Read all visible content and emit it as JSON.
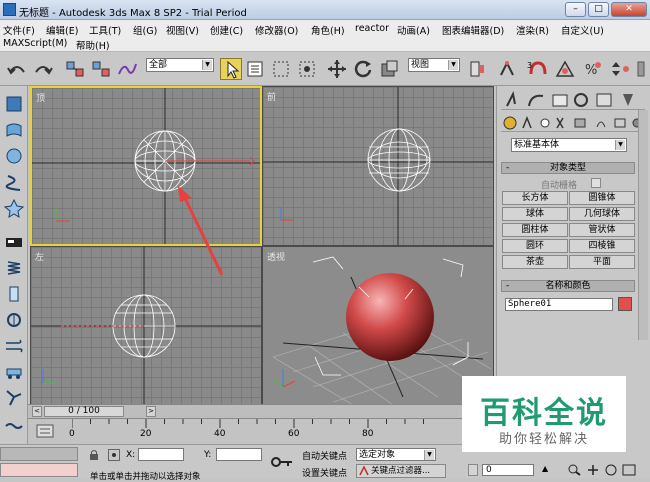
{
  "window": {
    "title": "无标题 - Autodesk 3ds Max 8 SP2 - Trial Period",
    "minimize": "–",
    "maximize": "□",
    "close": "✕"
  },
  "menu": {
    "row1": [
      "文件(F)",
      "编辑(E)",
      "工具(T)",
      "组(G)",
      "视图(V)",
      "创建(C)",
      "修改器(O)",
      "角色(H)",
      "reactor",
      "动画(A)",
      "图表编辑器(D)",
      "渲染(R)",
      "自定义(U)"
    ],
    "row2": [
      "MAXScript(M)",
      "帮助(H)"
    ]
  },
  "toolbar": {
    "selection_filter": "全部",
    "ref_coord": "视图"
  },
  "viewports": {
    "top": "顶",
    "front": "前",
    "left": "左",
    "persp": "透视"
  },
  "command_panel": {
    "category": "标准基本体",
    "object_type_header": "对象类型",
    "autogrid_label": "自动栅格",
    "primitives": [
      "长方体",
      "圆锥体",
      "球体",
      "几何球体",
      "圆柱体",
      "管状体",
      "圆环",
      "四棱锥",
      "茶壶",
      "平面"
    ],
    "name_color_header": "名称和颜色",
    "object_name": "Sphere01",
    "object_color": "#e05050"
  },
  "timeline": {
    "frame": "0 / 100",
    "ticks": [
      "0",
      "20",
      "40",
      "60",
      "80"
    ]
  },
  "status": {
    "x_label": "X:",
    "y_label": "Y:",
    "auto_key": "自动关键点",
    "set_key": "设置关键点",
    "key_mode": "选定对象",
    "key_filters": "关键点过滤器...",
    "frame_value": "0",
    "prompt": "单击或单击并拖动以选择对象"
  },
  "watermark": {
    "main": "百科全说",
    "sub": "助你轻松解决"
  },
  "colors": {
    "active_viewport_border": "#e7d23a",
    "sphere": "#d24a4a",
    "arrow": "#e84040"
  }
}
